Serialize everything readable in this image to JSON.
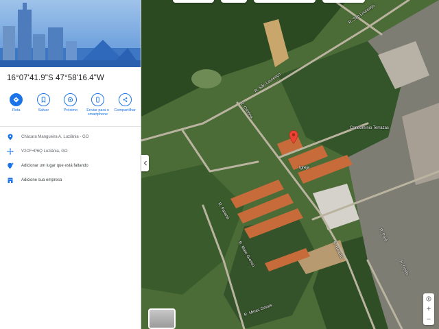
{
  "panel": {
    "coordinates": "16°07'41.9\"S 47°58'16.4\"W",
    "actions": [
      {
        "label": "Rota",
        "icon": "directions-icon",
        "filled": true
      },
      {
        "label": "Salvar",
        "icon": "bookmark-icon",
        "filled": false
      },
      {
        "label": "Próximo",
        "icon": "nearby-icon",
        "filled": false
      },
      {
        "label": "Enviar para o\nsmartphone",
        "icon": "send-to-phone-icon",
        "filled": false
      },
      {
        "label": "Compartilhar",
        "icon": "share-icon",
        "filled": false
      }
    ],
    "info": [
      {
        "text": "Chácara Mangueira A, Luziânia - GO",
        "icon": "location-pin-icon"
      },
      {
        "text": "V2CF+P6Q Luziânia, GO",
        "icon": "plus-code-icon"
      },
      {
        "text": "Adicionar um lugar que está faltando",
        "icon": "add-place-icon"
      },
      {
        "text": "Adicione sua empresa",
        "icon": "business-icon"
      }
    ]
  },
  "map": {
    "streets": [
      "R. São Lourenço",
      "R. São Lourenço",
      "R. Cristina",
      "R. Hercílio",
      "R. Paraná",
      "R. Mato Grosso",
      "R. Pará",
      "R. Minas Gerais",
      "R. Goiás"
    ],
    "places": [
      "Condomínio Terrazas",
      "Igreja"
    ],
    "controls": {
      "zoom_in": "+",
      "zoom_out": "−"
    }
  },
  "colors": {
    "accent": "#1a73e8",
    "pin": "#ea4335",
    "hero_sky": "#5b93d8"
  }
}
